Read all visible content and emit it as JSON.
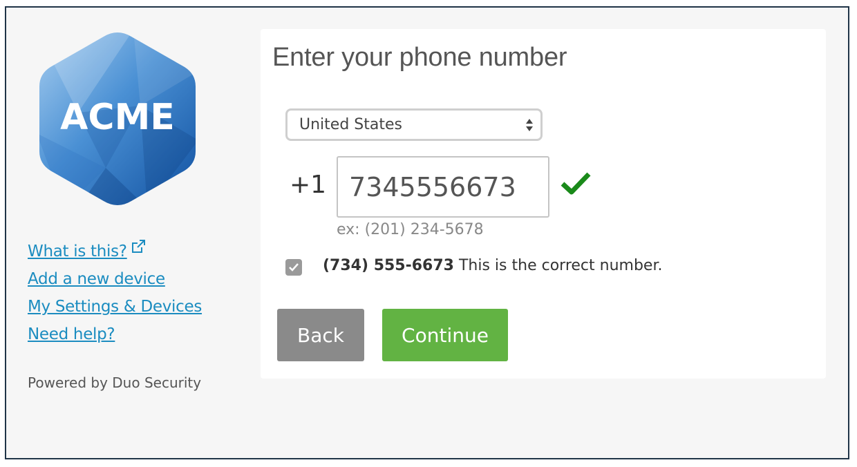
{
  "branding": {
    "logo_text": "ACME",
    "powered_by": "Powered by Duo Security"
  },
  "sidebar": {
    "links": [
      {
        "label": "What is this?",
        "icon": "external-link-icon"
      },
      {
        "label": "Add a new device"
      },
      {
        "label": "My Settings & Devices"
      },
      {
        "label": "Need help?"
      }
    ]
  },
  "main": {
    "title": "Enter your phone number",
    "country_select": {
      "value": "United States"
    },
    "phone": {
      "country_code": "+1",
      "value": "7345556673",
      "example": "ex: (201) 234-5678",
      "valid_icon": "checkmark-icon"
    },
    "confirm": {
      "checked": true,
      "number": "(734) 555-6673",
      "text": "This is the correct number."
    },
    "buttons": {
      "back": "Back",
      "continue": "Continue"
    }
  },
  "colors": {
    "link": "#1b8cc0",
    "continue_button": "#62b343",
    "back_button": "#8a8a8a",
    "valid_check": "#1a8a1a",
    "frame_border": "#1f3447"
  }
}
